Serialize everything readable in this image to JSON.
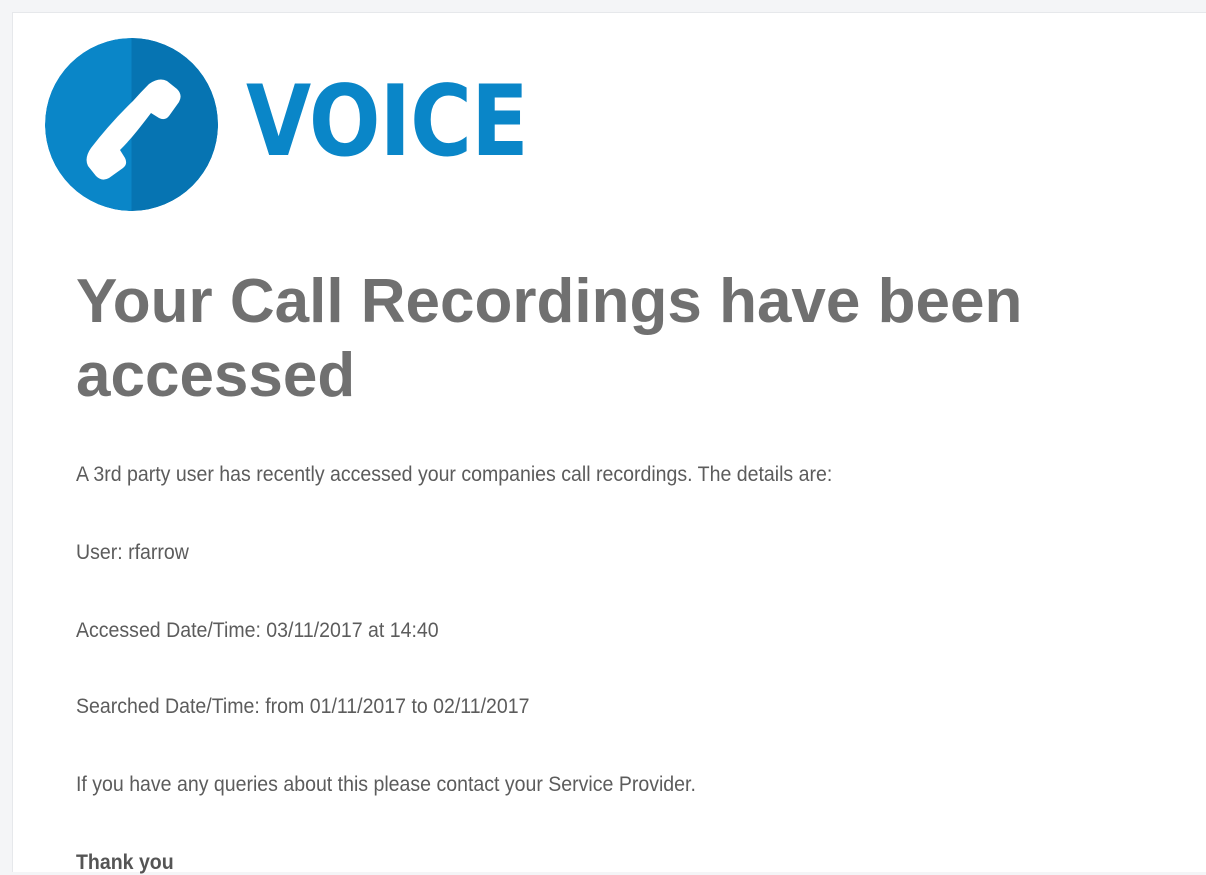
{
  "logo": {
    "icon": "phone-handset-icon",
    "wordmark": "VOICE",
    "brand_color": "#0a86c8",
    "brand_color_dark": "#0674b2"
  },
  "email": {
    "heading": "Your Call Recordings have been accessed",
    "intro": "A 3rd party user has recently accessed your companies call recordings. The details are:",
    "user_line": "User: rfarrow",
    "accessed_line": "Accessed Date/Time: 03/11/2017 at 14:40",
    "searched_line": "Searched Date/Time: from 01/11/2017 to 02/11/2017",
    "queries_line": "If you have any queries about this please contact your Service Provider.",
    "signoff": "Thank you"
  },
  "colors": {
    "heading": "#707070",
    "body_text": "#5c5c5c",
    "background": "#f4f5f7"
  }
}
